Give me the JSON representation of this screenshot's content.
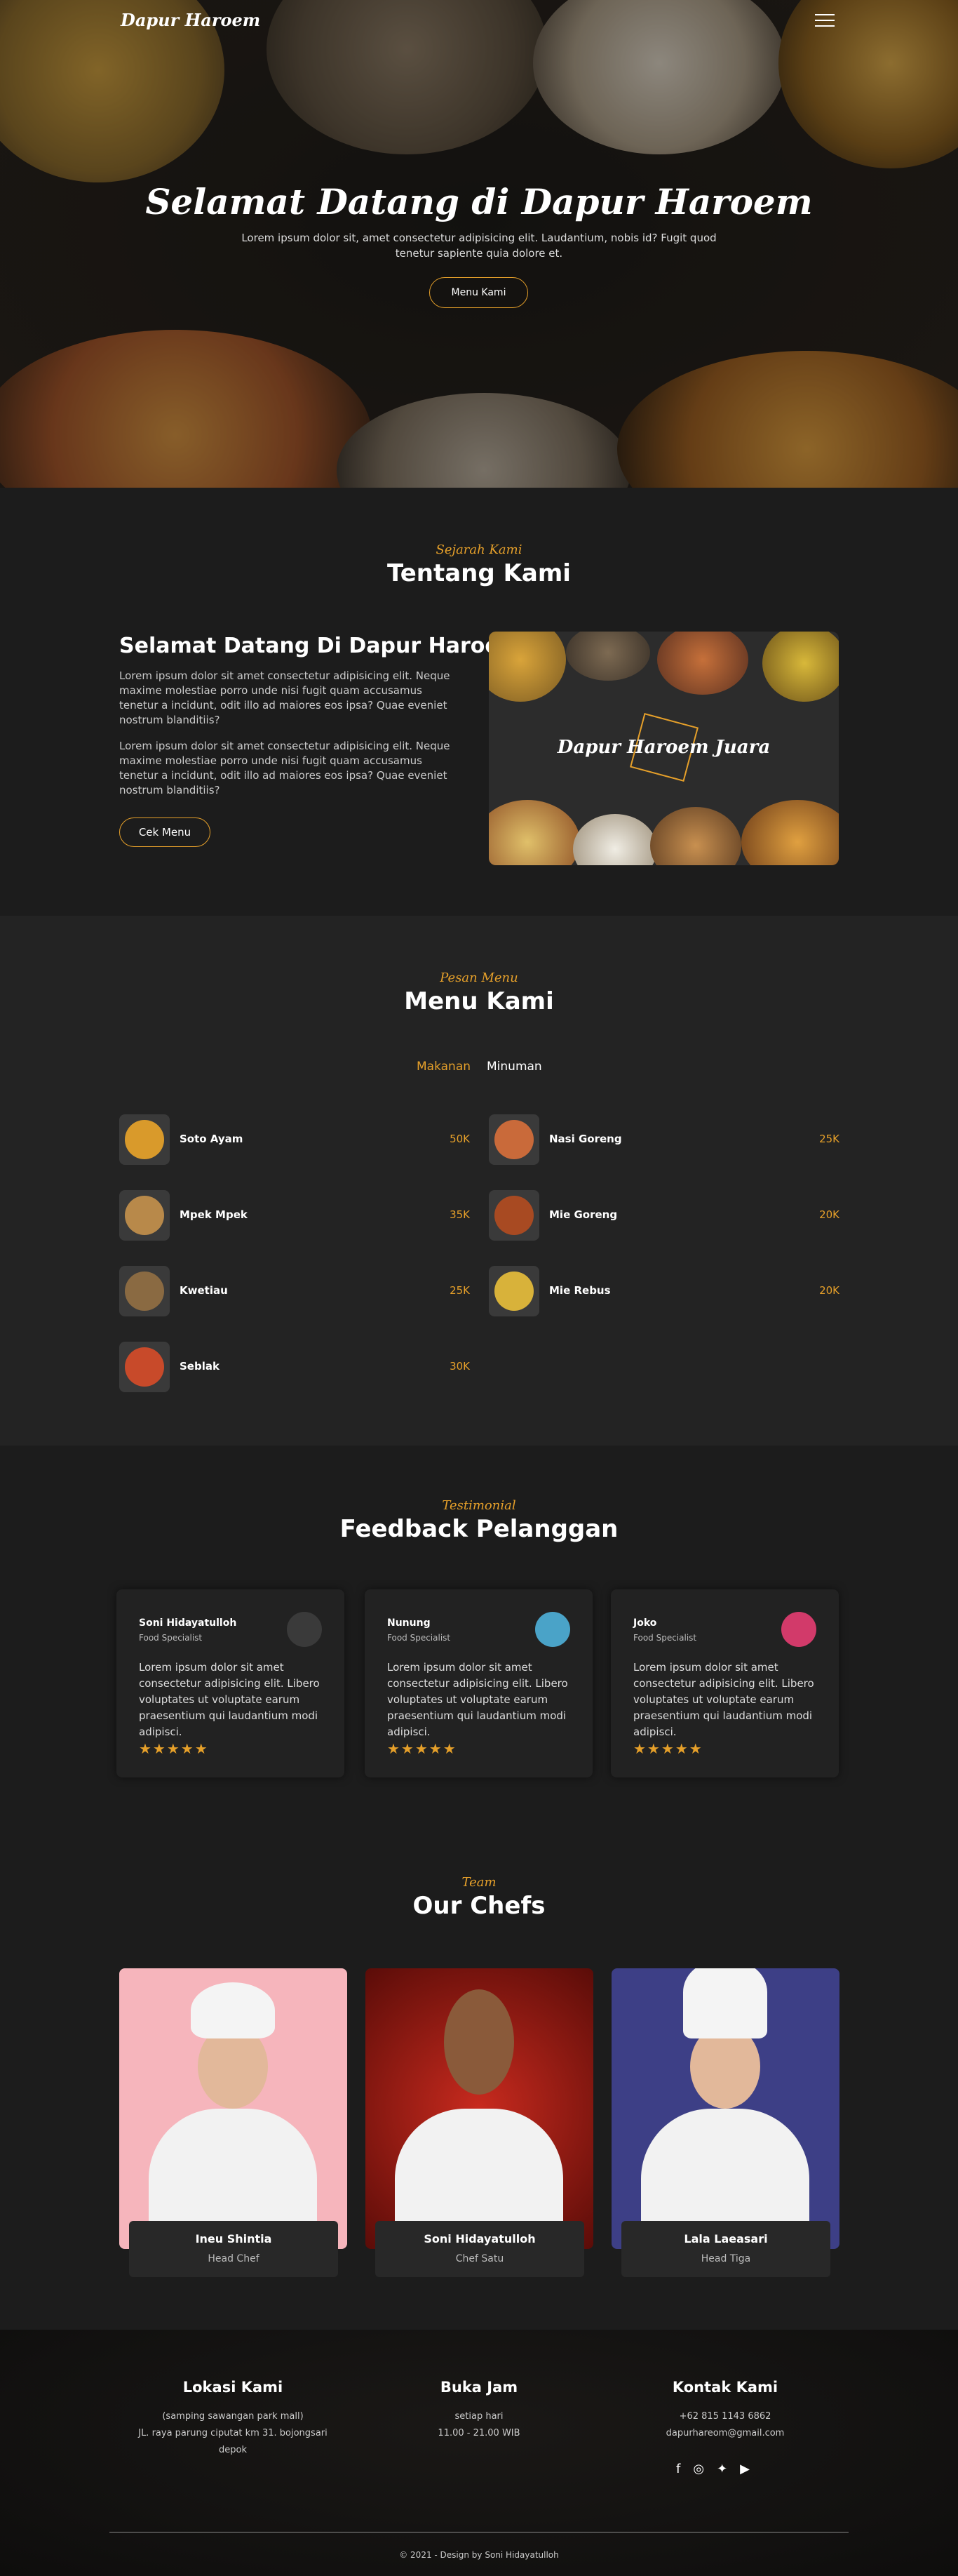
{
  "nav": {
    "brand": "Dapur Haroem"
  },
  "hero": {
    "title": "Selamat Datang di Dapur Haroem",
    "subtitle": "Lorem ipsum dolor sit, amet consectetur adipisicing elit. Laudantium, nobis id? Fugit quod tenetur sapiente quia dolore et.",
    "button": "Menu Kami"
  },
  "about": {
    "kicker": "Sejarah Kami",
    "title": "Tentang Kami",
    "heading": "Selamat Datang Di Dapur Haroem",
    "para1": "Lorem ipsum dolor sit amet consectetur adipisicing elit. Neque maxime molestiae porro unde nisi fugit quam accusamus tenetur a incidunt, odit illo ad maiores eos ipsa? Quae eveniet nostrum blanditiis?",
    "para2": "Lorem ipsum dolor sit amet consectetur adipisicing elit. Neque maxime molestiae porro unde nisi fugit quam accusamus tenetur a incidunt, odit illo ad maiores eos ipsa? Quae eveniet nostrum blanditiis?",
    "button": "Cek Menu",
    "image_text": "Dapur Haroem Juara"
  },
  "menu": {
    "kicker": "Pesan Menu",
    "title": "Menu Kami",
    "tabs": [
      "Makanan",
      "Minuman"
    ],
    "items": [
      {
        "name": "Soto Ayam",
        "price": "50K",
        "color": "#d99a2b"
      },
      {
        "name": "Nasi Goreng",
        "price": "25K",
        "color": "#c96a3a"
      },
      {
        "name": "Mpek Mpek",
        "price": "35K",
        "color": "#b8894a"
      },
      {
        "name": "Mie Goreng",
        "price": "20K",
        "color": "#a84a22"
      },
      {
        "name": "Kwetiau",
        "price": "25K",
        "color": "#8a6a42"
      },
      {
        "name": "Mie Rebus",
        "price": "20K",
        "color": "#d8b23a"
      },
      {
        "name": "Seblak",
        "price": "30K",
        "color": "#c84a2a"
      }
    ]
  },
  "testimonials": {
    "kicker": "Testimonial",
    "title": "Feedback Pelanggan",
    "items": [
      {
        "name": "Soni Hidayatulloh",
        "role": "Food Specialist",
        "text": "Lorem ipsum dolor sit amet consectetur adipisicing elit. Libero voluptates ut voluptate earum praesentium qui laudantium modi adipisci.",
        "stars": "★★★★★",
        "avatar": "#3a3a3a"
      },
      {
        "name": "Nunung",
        "role": "Food Specialist",
        "text": "Lorem ipsum dolor sit amet consectetur adipisicing elit. Libero voluptates ut voluptate earum praesentium qui laudantium modi adipisci.",
        "stars": "★★★★★",
        "avatar": "#4aa3c8"
      },
      {
        "name": "Joko",
        "role": "Food Specialist",
        "text": "Lorem ipsum dolor sit amet consectetur adipisicing elit. Libero voluptates ut voluptate earum praesentium qui laudantium modi adipisci.",
        "stars": "★★★★★",
        "avatar": "#d23a6a"
      }
    ]
  },
  "chefs": {
    "kicker": "Team",
    "title": "Our Chefs",
    "items": [
      {
        "name": "Ineu Shintia",
        "role": "Head Chef",
        "bg": "#f6b5bc"
      },
      {
        "name": "Soni Hidayatulloh",
        "role": "Chef Satu",
        "bg": "#a81a14"
      },
      {
        "name": "Lala Laeasari",
        "role": "Head Tiga",
        "bg": "#3d3f86"
      }
    ]
  },
  "footer": {
    "location": {
      "title": "Lokasi Kami",
      "line1": "(samping sawangan park mall)",
      "line2": "JL. raya parung ciputat km 31. bojongsari",
      "line3": "depok"
    },
    "hours": {
      "title": "Buka Jam",
      "line1": "setiap hari",
      "line2": "11.00 - 21.00 WIB"
    },
    "contact": {
      "title": "Kontak Kami",
      "phone": "+62 815 1143 6862",
      "email": "dapurhareom@gmail.com"
    },
    "social": [
      "facebook-icon",
      "instagram-icon",
      "twitter-icon",
      "youtube-icon"
    ],
    "copyright": "© 2021 - Design by Soni Hidayatulloh"
  },
  "colors": {
    "accent": "#e6a02a",
    "background": "#1c1c1c"
  }
}
